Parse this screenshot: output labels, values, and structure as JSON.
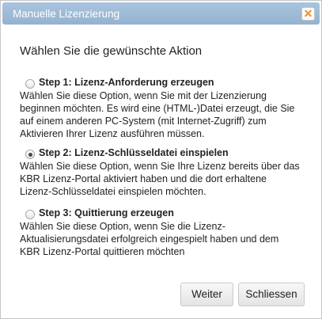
{
  "dialog": {
    "title": "Manuelle Lizenzierung",
    "close_icon_glyph": "✕",
    "heading": "Wählen Sie die gewünschte Aktion"
  },
  "options": [
    {
      "label": "Step 1: Lizenz-Anforderung erzeugen",
      "checked": false,
      "lines": [
        "Wählen Sie diese Option, wenn Sie mit der Lizenzierung",
        "beginnen möchten. Es wird eine (HTML-)Datei erzeugt, die Sie",
        "auf einem anderen PC-System (mit Internet-Zugriff) zum",
        "Aktivieren Ihrer Lizenz ausführen müssen."
      ]
    },
    {
      "label": "Step 2: Lizenz-Schlüsseldatei einspielen",
      "checked": true,
      "lines": [
        "Wählen Sie diese Option, wenn Sie Ihre Lizenz bereits über das",
        "KBR Lizenz-Portal aktiviert haben und die dort erhaltene",
        "Lizenz-Schlüsseldatei einspielen möchten."
      ]
    },
    {
      "label": "Step 3: Quittierung erzeugen",
      "checked": false,
      "lines": [
        "Wählen Sie diese Option, wenn Sie die Lizenz-",
        "Aktualisierungsdatei erfolgreich eingespielt haben und dem",
        "KBR Lizenz-Portal quittieren möchten"
      ]
    }
  ],
  "buttons": {
    "next_label": "Weiter",
    "close_label": "Schliessen"
  },
  "colors": {
    "titlebar": "#9fbcd9",
    "close_icon": "#e8902b"
  },
  "icons": {
    "close": "close-icon"
  }
}
